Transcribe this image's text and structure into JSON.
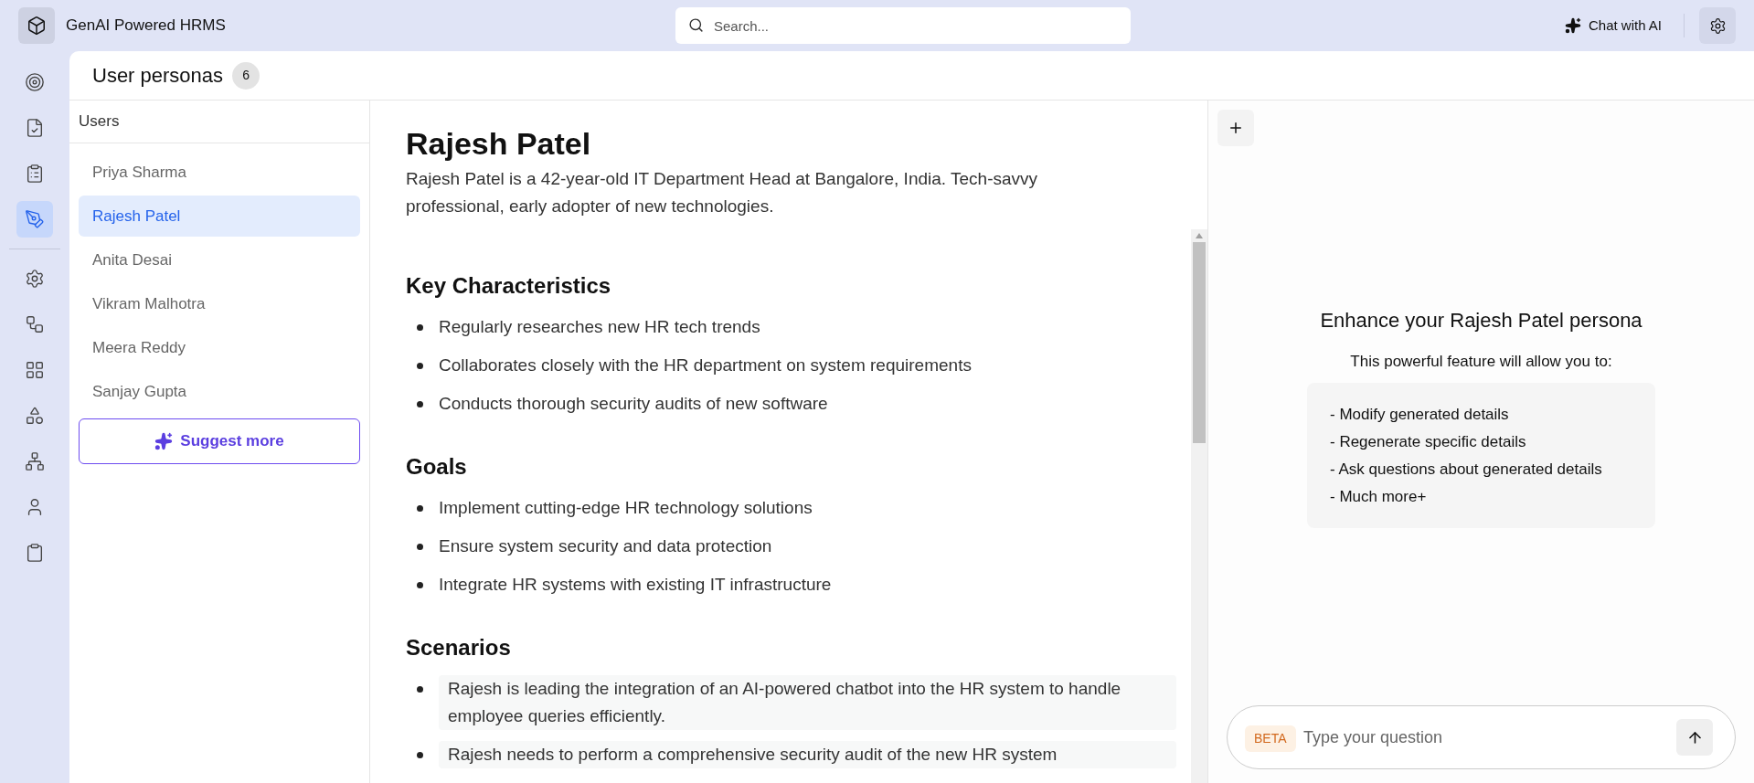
{
  "app": {
    "title": "GenAI Powered HRMS"
  },
  "search": {
    "placeholder": "Search..."
  },
  "chat_button": {
    "label": "Chat with AI"
  },
  "nav": [
    {
      "kind": "target",
      "selected": false
    },
    {
      "kind": "document",
      "selected": false
    },
    {
      "kind": "clipboard-list",
      "selected": false
    },
    {
      "kind": "pen",
      "selected": true
    }
  ],
  "nav_lower": [
    {
      "kind": "settings",
      "selected": false
    },
    {
      "kind": "cog-network",
      "selected": false
    },
    {
      "kind": "blocks",
      "selected": false
    },
    {
      "kind": "shapes",
      "selected": false
    },
    {
      "kind": "hierarchy",
      "selected": false
    },
    {
      "kind": "user",
      "selected": false
    },
    {
      "kind": "clipboard",
      "selected": false
    }
  ],
  "page": {
    "title": "User personas",
    "count": "6"
  },
  "users": {
    "heading": "Users",
    "items": [
      {
        "name": "Priya Sharma",
        "selected": false
      },
      {
        "name": "Rajesh Patel",
        "selected": true
      },
      {
        "name": "Anita Desai",
        "selected": false
      },
      {
        "name": "Vikram Malhotra",
        "selected": false
      },
      {
        "name": "Meera Reddy",
        "selected": false
      },
      {
        "name": "Sanjay Gupta",
        "selected": false
      }
    ],
    "suggest_button": "Suggest more"
  },
  "persona": {
    "name": "Rajesh Patel",
    "summary": "Rajesh Patel is a 42-year-old IT Department Head at Bangalore, India. Tech-savvy professional, early adopter of new technologies.",
    "sections": [
      {
        "heading": "Key Characteristics",
        "kind": "plain",
        "items": [
          "Regularly researches new HR tech trends",
          "Collaborates closely with the HR department on system requirements",
          "Conducts thorough security audits of new software"
        ]
      },
      {
        "heading": "Goals",
        "kind": "plain",
        "items": [
          "Implement cutting-edge HR technology solutions",
          "Ensure system security and data protection",
          "Integrate HR systems with existing IT infrastructure"
        ]
      },
      {
        "heading": "Scenarios",
        "kind": "shaded",
        "items": [
          "Rajesh is leading the integration of an AI-powered chatbot into the HR system to handle employee queries efficiently.",
          "Rajesh needs to perform a comprehensive security audit of the new HR system"
        ]
      }
    ]
  },
  "enhance": {
    "title": "Enhance your Rajesh Patel persona",
    "subtitle": "This powerful feature will allow you to:",
    "features": [
      "- Modify generated details",
      "- Regenerate specific details",
      "- Ask questions about generated details",
      "- Much more+"
    ]
  },
  "chat": {
    "badge": "BETA",
    "placeholder": "Type your question"
  }
}
